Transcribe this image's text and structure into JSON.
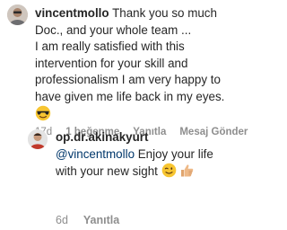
{
  "comment1": {
    "username": "vincentmollo",
    "text_line1": "Thank you so much",
    "text_line2": "Doc., and your whole team ...",
    "text_line3": " I am really satisfied with this",
    "text_line4": "intervention for your skill and",
    "text_line5": "professionalism I am very happy to",
    "text_line6": "have given me life back in my eyes.",
    "emoji_icon": "sunglasses-emoji-icon",
    "time": "17d",
    "likes": "1 beğenme",
    "reply_label": "Yanıtla",
    "send_label": "Mesaj Gönder"
  },
  "comment2": {
    "username": "op.dr.akinakyurt",
    "mention": "@vincentmollo",
    "text_line1": " Enjoy your life",
    "text_line2": "with your new sight",
    "emoji_icons": [
      "winking-face-emoji-icon",
      "thumbs-up-emoji-icon"
    ],
    "time": "6d",
    "reply_label": "Yanıtla"
  }
}
